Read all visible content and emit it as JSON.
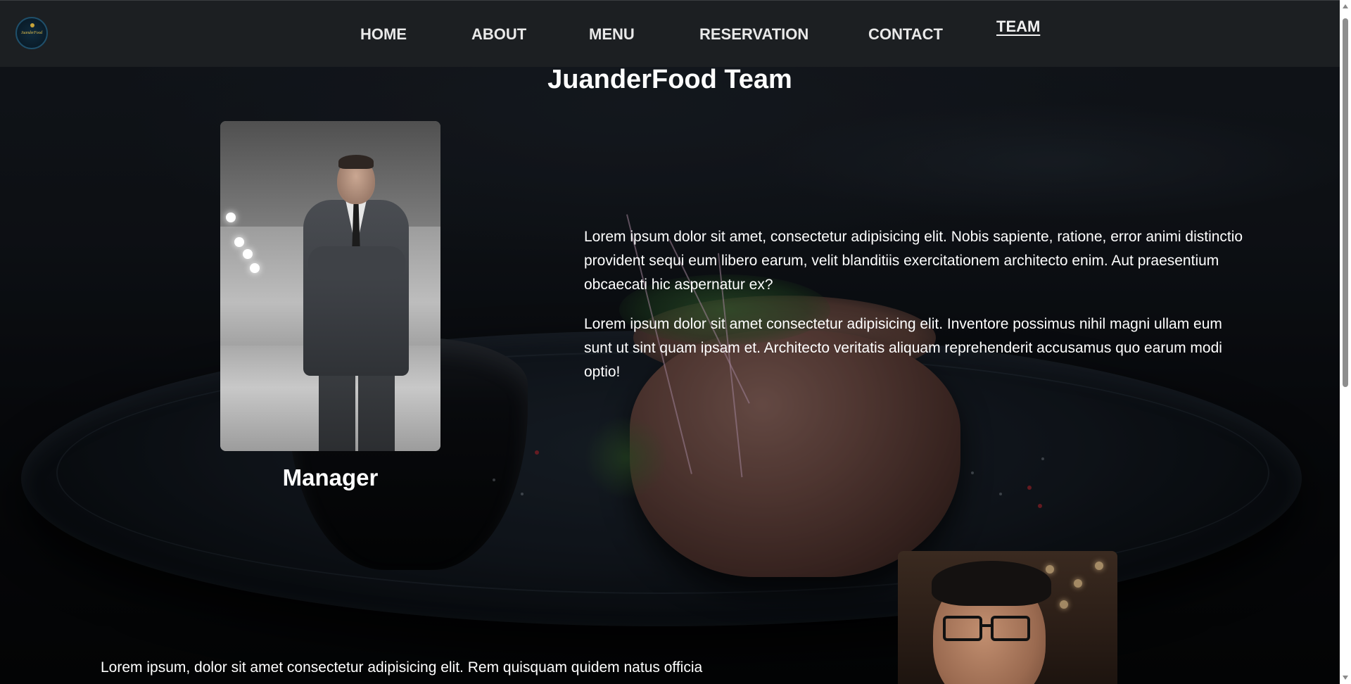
{
  "navbar": {
    "logo_text": "JuanderFood",
    "links": [
      {
        "label": "HOME",
        "active": false
      },
      {
        "label": "ABOUT",
        "active": false
      },
      {
        "label": "MENU",
        "active": false
      },
      {
        "label": "RESERVATION",
        "active": false
      },
      {
        "label": "CONTACT",
        "active": false
      },
      {
        "label": "TEAM",
        "active": true
      }
    ]
  },
  "main": {
    "title": "JuanderFood Team",
    "members": [
      {
        "role": "Manager",
        "photo": "manager-portrait"
      },
      {
        "photo": "team-member-portrait"
      }
    ],
    "paragraphs": [
      "Lorem ipsum dolor sit amet, consectetur adipisicing elit. Nobis sapiente, ratione, error animi distinctio provident sequi eum libero earum, velit blanditiis exercitationem architecto enim. Aut praesentium obcaecati hic aspernatur ex?",
      "Lorem ipsum dolor sit amet consectetur adipisicing elit. Inventore possimus nihil magni ullam eum sunt ut sint quam ipsam et. Architecto veritatis aliquam reprehenderit accusamus quo earum modi optio!",
      "Lorem ipsum, dolor sit amet consectetur adipisicing elit. Rem quisquam quidem natus officia"
    ]
  },
  "colors": {
    "navbar_bg": "#1c1f22",
    "text": "#ffffff",
    "nav_text": "#e9e9e9"
  },
  "icons": {
    "logo": "juanderfood-logo-icon",
    "scroll_up": "chevron-up-icon",
    "scroll_down": "chevron-down-icon"
  }
}
